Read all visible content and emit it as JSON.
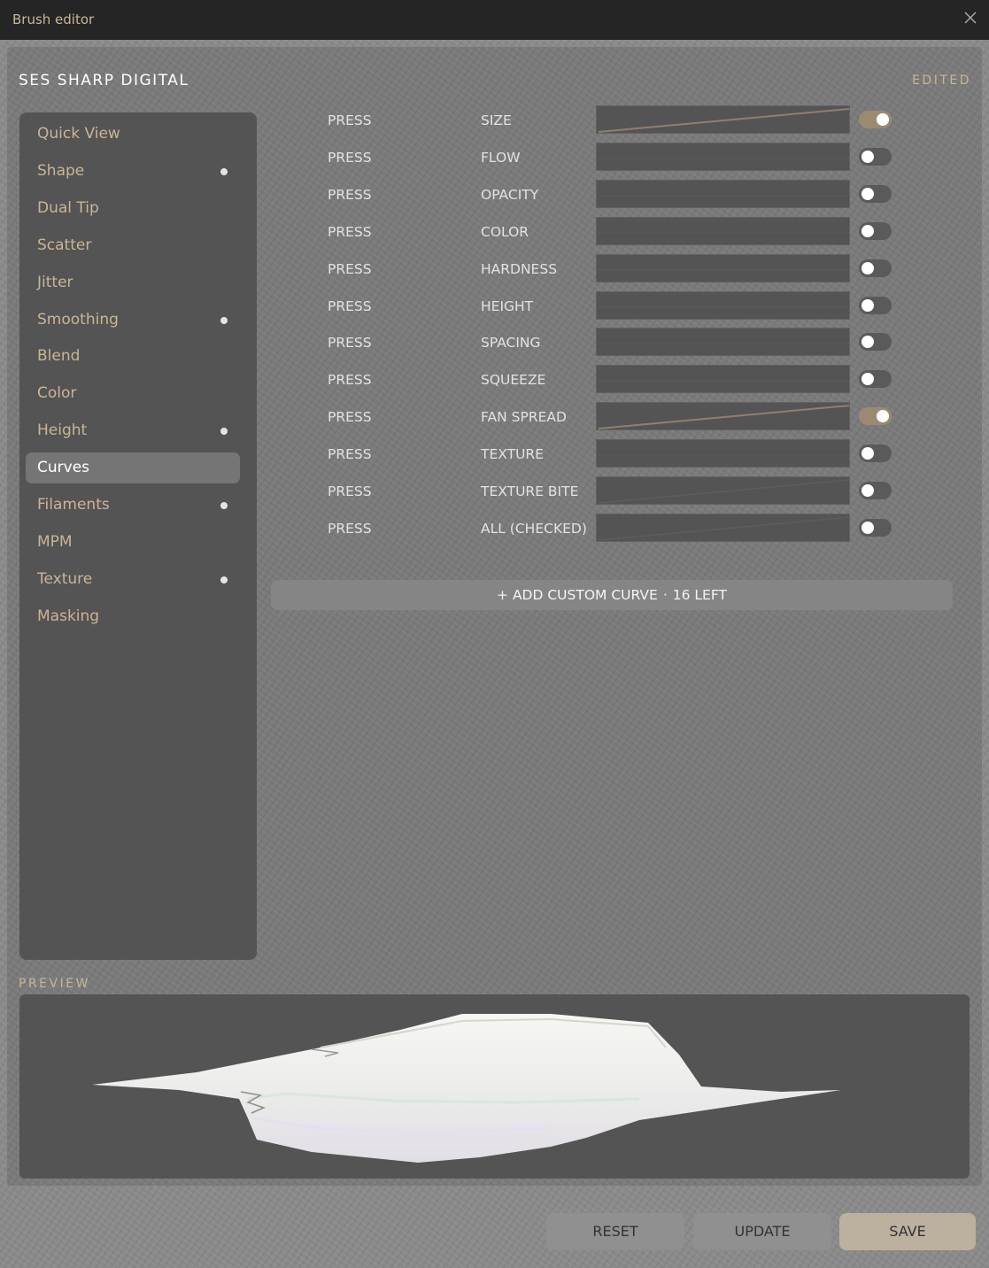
{
  "window": {
    "title": "Brush editor",
    "close_icon": "close-icon"
  },
  "header": {
    "brush_name": "SES SHARP DIGITAL",
    "status": "EDITED"
  },
  "sidebar": {
    "items": [
      {
        "label": "Quick View",
        "dot": false
      },
      {
        "label": "Shape",
        "dot": true
      },
      {
        "label": "Dual Tip",
        "dot": false
      },
      {
        "label": "Scatter",
        "dot": false
      },
      {
        "label": "Jitter",
        "dot": false
      },
      {
        "label": "Smoothing",
        "dot": true
      },
      {
        "label": "Blend",
        "dot": false
      },
      {
        "label": "Color",
        "dot": false
      },
      {
        "label": "Height",
        "dot": true
      },
      {
        "label": "Curves",
        "dot": false,
        "active": true
      },
      {
        "label": "Filaments",
        "dot": true
      },
      {
        "label": "MPM",
        "dot": false
      },
      {
        "label": "Texture",
        "dot": true
      },
      {
        "label": "Masking",
        "dot": false
      }
    ]
  },
  "curves": {
    "rows": [
      {
        "source": "PRESS",
        "property": "SIZE",
        "enabled": true,
        "curve": "linear"
      },
      {
        "source": "PRESS",
        "property": "FLOW",
        "enabled": false,
        "curve": "flat"
      },
      {
        "source": "PRESS",
        "property": "OPACITY",
        "enabled": false,
        "curve": "flat"
      },
      {
        "source": "PRESS",
        "property": "COLOR",
        "enabled": false,
        "curve": "flat"
      },
      {
        "source": "PRESS",
        "property": "HARDNESS",
        "enabled": false,
        "curve": "flat"
      },
      {
        "source": "PRESS",
        "property": "HEIGHT",
        "enabled": false,
        "curve": "flat"
      },
      {
        "source": "PRESS",
        "property": "SPACING",
        "enabled": false,
        "curve": "flat"
      },
      {
        "source": "PRESS",
        "property": "SQUEEZE",
        "enabled": false,
        "curve": "flat"
      },
      {
        "source": "PRESS",
        "property": "FAN SPREAD",
        "enabled": true,
        "curve": "linear"
      },
      {
        "source": "PRESS",
        "property": "TEXTURE",
        "enabled": false,
        "curve": "flat"
      },
      {
        "source": "PRESS",
        "property": "TEXTURE BITE",
        "enabled": false,
        "curve": "linear-faint"
      },
      {
        "source": "PRESS",
        "property": "ALL (CHECKED)",
        "enabled": false,
        "curve": "linear-faint"
      }
    ],
    "add_label": "+ ADD CUSTOM CURVE",
    "separator": "·",
    "remaining": "16 LEFT"
  },
  "preview": {
    "label": "PREVIEW"
  },
  "footer": {
    "reset": "RESET",
    "update": "UPDATE",
    "save": "SAVE"
  },
  "colors": {
    "accent": "#c9b596",
    "toggle_on": "#9a8a72",
    "save_button": "#bcb09e"
  }
}
